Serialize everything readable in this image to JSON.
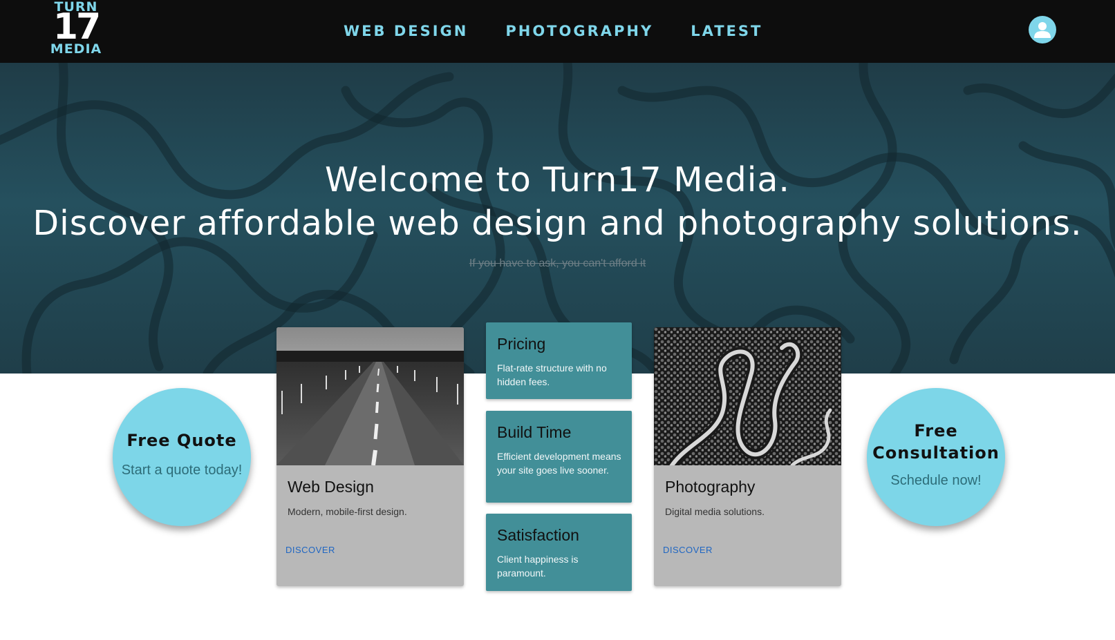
{
  "nav": {
    "logo": {
      "top": "TURN",
      "mid": "17",
      "bottom": "MEDIA"
    },
    "links": [
      "WEB DESIGN",
      "PHOTOGRAPHY",
      "LATEST"
    ],
    "account_icon": "user-icon"
  },
  "hero": {
    "title_line1": "Welcome to Turn17 Media.",
    "title_line2": "Discover affordable web design and photography solutions.",
    "tagline": "If you have to ask, you can't afford it"
  },
  "circles": {
    "quote": {
      "title": "Free Quote",
      "subtitle": "Start a quote today!"
    },
    "consultation": {
      "title_line1": "Free",
      "title_line2": "Consultation",
      "subtitle": "Schedule now!"
    }
  },
  "cards": [
    {
      "title": "Web Design",
      "text": "Modern, mobile-first design.",
      "link": "DISCOVER",
      "image": "road-photo"
    },
    {
      "title": "Photography",
      "text": "Digital media solutions.",
      "link": "DISCOVER",
      "image": "winding-road-aerial-photo"
    }
  ],
  "features": [
    {
      "title": "Pricing",
      "text": "Flat-rate structure with no hidden fees."
    },
    {
      "title": "Build Time",
      "text": "Efficient development means your site goes live sooner."
    },
    {
      "title": "Satisfaction",
      "text": "Client happiness is paramount."
    }
  ],
  "colors": {
    "nav_bg": "#0d0d0d",
    "accent": "#7fd6ea",
    "hero_bg": "#25505e",
    "feature_bg": "#428f98",
    "card_bg": "#b8b8b8",
    "link": "#1f66c2"
  }
}
